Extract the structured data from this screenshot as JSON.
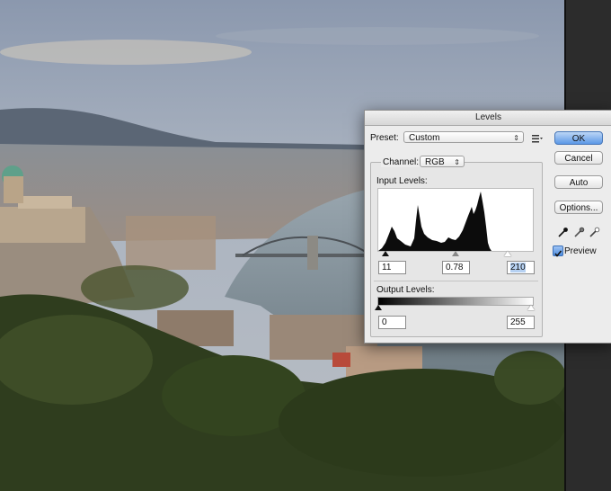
{
  "dialog": {
    "title": "Levels",
    "preset": {
      "label": "Preset:",
      "value": "Custom"
    },
    "channel": {
      "label": "Channel:",
      "value": "RGB"
    },
    "input_levels": {
      "label": "Input Levels:",
      "black": "11",
      "gamma": "0.78",
      "white": "210"
    },
    "output_levels": {
      "label": "Output Levels:",
      "black": "0",
      "white": "255"
    },
    "buttons": {
      "ok": "OK",
      "cancel": "Cancel",
      "auto": "Auto",
      "options": "Options..."
    },
    "preview": {
      "label": "Preview",
      "checked": true
    }
  },
  "colors": {
    "accent": "#5b98e6",
    "dialog_bg": "#ececec"
  },
  "icons": [
    "preset-menu-icon",
    "black-eyedropper-icon",
    "gray-eyedropper-icon",
    "white-eyedropper-icon"
  ]
}
